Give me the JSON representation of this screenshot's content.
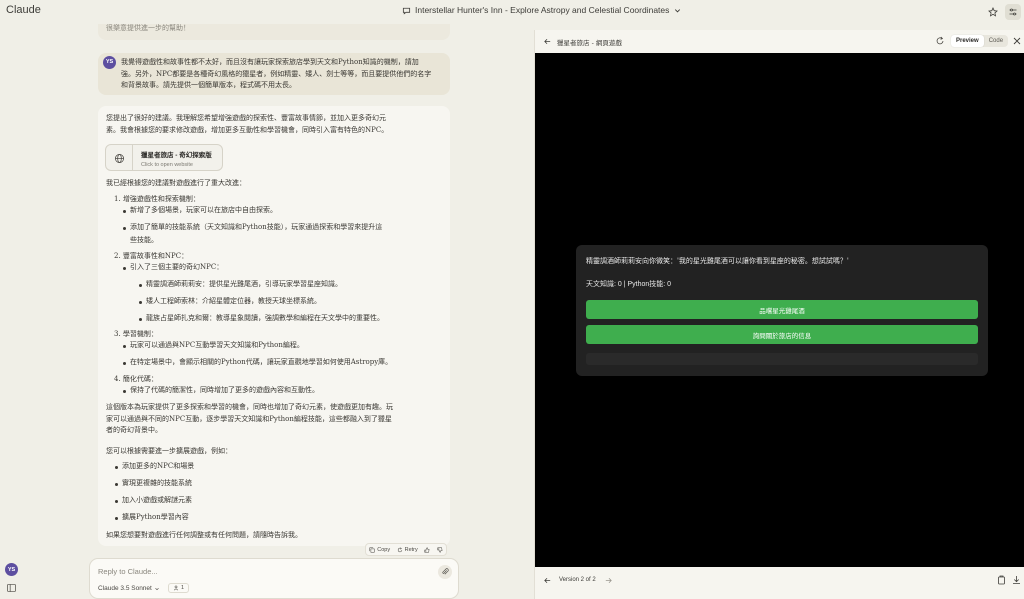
{
  "app": {
    "name": "Claude"
  },
  "header": {
    "chat_title": "Interstellar Hunter's Inn - Explore Astropy and Celestial Coordinates"
  },
  "chat": {
    "prev_ai_tail": "很樂意提供進一步的幫助！",
    "user_message": {
      "avatar": "YS",
      "lines": [
        "我覺得遊戲性和故事性都不太好，而且沒有讓玩家探索旅店學到天文和Python知識的機制，請加",
        "強。另外，NPC都要是各種奇幻風格的獵星者，例如精靈、矮人、劍士等等，而且要提供他們的名字",
        "和背景故事。請先提供一個簡單版本，程式碼不用太長。"
      ]
    },
    "ai_message": {
      "intro": [
        "您提出了很好的建議。我理解您希望增強遊戲的探索性、豐富故事情節，並加入更多奇幻元",
        "素。我會根據您的要求修改遊戲，增加更多互動性和學習機會，同時引入富有特色的NPC。"
      ],
      "artifact_card": {
        "title": "獵星者旅店 - 奇幻探索版",
        "subtitle": "Click to open website"
      },
      "changes_heading": "我已經根據您的建議對遊戲進行了重大改進：",
      "sections": [
        {
          "title": "1. 增強遊戲性和探索機制：",
          "items": [
            "新增了多個場景，玩家可以在旅店中自由探索。",
            "添加了簡單的技能系統（天文知識和Python技能），玩家通過探索和學習來提升這",
            "些技能。"
          ]
        },
        {
          "title": "2. 豐富故事性和NPC：",
          "items": [
            "引入了三個主要的奇幻NPC：",
            "精靈調酒師莉莉安：提供星光雞尾酒，引導玩家學習星座知識。",
            "矮人工程師索林：介紹星體定位器，教授天球坐標系統。",
            "龍族占星師扎克和爾：教導星象閱讀，強調數學和編程在天文學中的重要性。"
          ]
        },
        {
          "title": "3. 學習機制：",
          "items": [
            "玩家可以通過與NPC互動學習天文知識和Python編程。",
            "在特定場景中，會顯示相關的Python代碼，讓玩家直觀地學習如何使用Astropy庫。"
          ]
        },
        {
          "title": "4. 簡化代碼：",
          "items": [
            "保持了代碼的簡潔性，同時增加了更多的遊戲內容和互動性。"
          ]
        }
      ],
      "summary": [
        "這個版本為玩家提供了更多探索和學習的機會，同時也增加了奇幻元素，使遊戲更加有趣。玩",
        "家可以通過與不同的NPC互動，逐步學習天文知識和Python編程技能，這些都融入到了獵星",
        "者的奇幻背景中。"
      ],
      "further_heading": "您可以根據需要進一步擴展遊戲，例如：",
      "further_items": [
        "添加更多的NPC和場景",
        "實現更複雜的技能系統",
        "加入小遊戲或解謎元素",
        "擴展Python學習內容"
      ],
      "closing": "如果您想要對遊戲進行任何調整或有任何問題，請隨時告訴我。"
    },
    "actions": {
      "copy": "Copy",
      "retry": "Retry"
    },
    "reply": {
      "placeholder": "Reply to Claude...",
      "model": "Claude 3.5 Sonnet",
      "style_count": "1"
    },
    "user_avatar": "YS"
  },
  "panel": {
    "title": "獵星者旅店 - 網頁遊戲",
    "preview_label": "Preview",
    "code_label": "Code",
    "game": {
      "dialogue": "精靈調酒師莉莉安向你微笑：'我的星光雞尾酒可以讓你看到星座的秘密。想試試嗎？'",
      "stats": "天文知識: 0 | Python技能: 0",
      "choice_1": "品嚐星光雞尾酒",
      "choice_2": "詢問關於旅店的信息"
    },
    "version": "Version 2 of 2"
  },
  "colors": {
    "accent_green": "#3fae4e",
    "avatar_purple": "#5d4fa0",
    "background": "#f0efe7"
  }
}
